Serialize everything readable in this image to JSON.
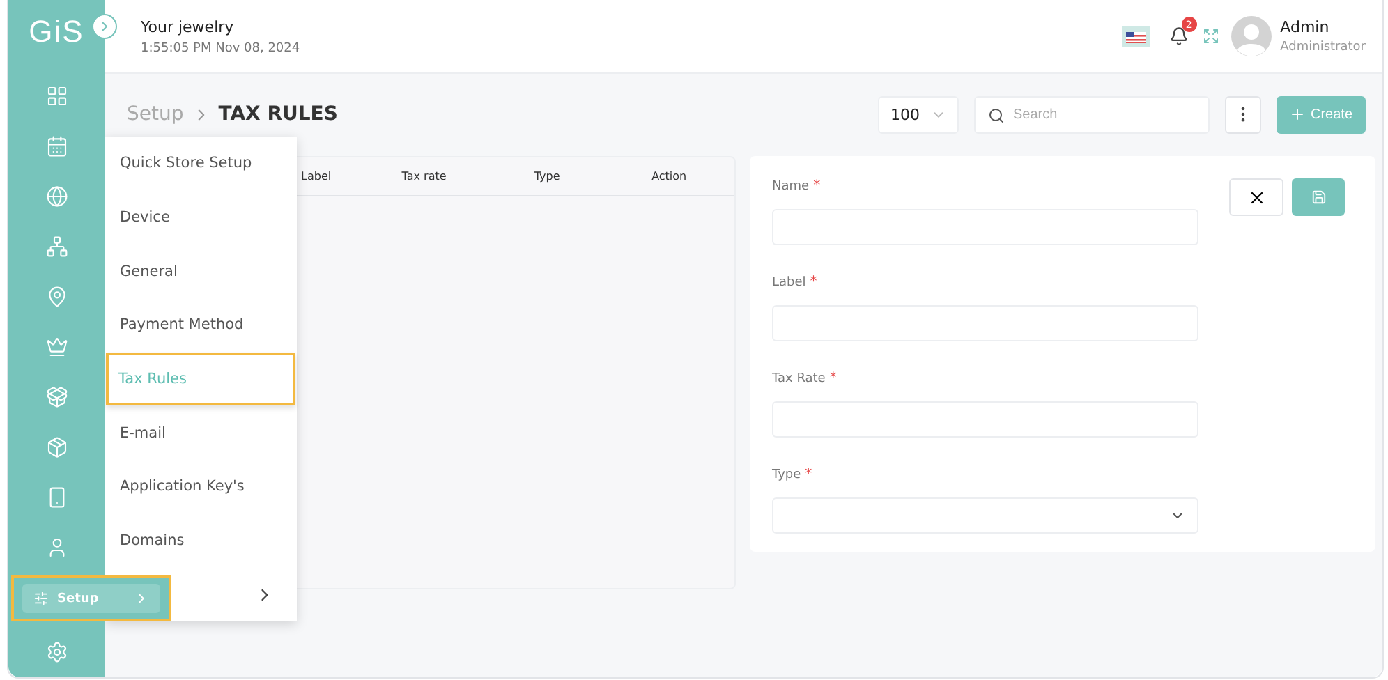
{
  "logo": "GiS",
  "header": {
    "store": "Your jewelry",
    "datetime": "1:55:05 PM Nov 08, 2024",
    "notifications": "2",
    "user": {
      "name": "Admin",
      "role": "Administrator"
    }
  },
  "sidebar": {
    "setup": {
      "label": "Setup",
      "selected": true
    }
  },
  "breadcrumb": {
    "parent": "Setup",
    "current": "TAX RULES"
  },
  "toolbar": {
    "page_size": "100",
    "search": {
      "placeholder": "Search"
    },
    "create": "Create"
  },
  "setup_menu": [
    {
      "label": "Quick Store Setup",
      "selected": false
    },
    {
      "label": "Device",
      "selected": false
    },
    {
      "label": "General",
      "selected": false
    },
    {
      "label": "Payment Method",
      "selected": false
    },
    {
      "label": "Tax Rules",
      "selected": true
    },
    {
      "label": "E-mail",
      "selected": false
    },
    {
      "label": "Application Key's",
      "selected": false
    },
    {
      "label": "Domains",
      "selected": false
    }
  ],
  "table": {
    "columns": [
      "Label",
      "Tax rate",
      "Type",
      "Action"
    ]
  },
  "form": {
    "fields": [
      {
        "label": "Name",
        "required_mark": "*",
        "kind": "text"
      },
      {
        "label": "Label",
        "required_mark": "*",
        "kind": "text"
      },
      {
        "label": "Tax Rate",
        "required_mark": "*",
        "kind": "text"
      },
      {
        "label": "Type",
        "required_mark": "*",
        "kind": "select"
      }
    ]
  }
}
